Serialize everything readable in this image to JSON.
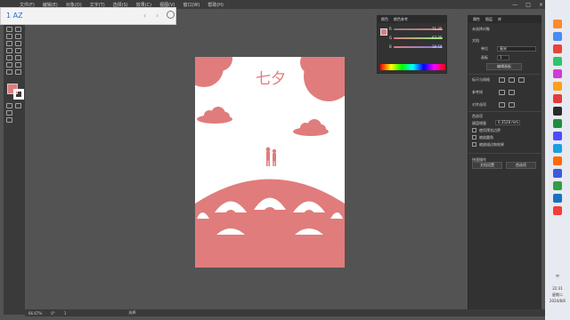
{
  "menubar": {
    "items": [
      "文件(F)",
      "编辑(E)",
      "对象(O)",
      "文字(T)",
      "选择(S)",
      "效果(C)",
      "视图(V)",
      "窗口(W)",
      "帮助(H)"
    ],
    "window_controls": [
      "—",
      "□",
      "×"
    ]
  },
  "browser_tab": {
    "title": "AZ",
    "tab_index": "1",
    "back": "‹",
    "forward": "›"
  },
  "artboard": {
    "headline": "七夕",
    "fill_color": "#e07c7c"
  },
  "color_panel": {
    "tabs": [
      "颜色",
      "颜色参考"
    ],
    "channels": [
      {
        "label": "R",
        "value": "71.25"
      },
      {
        "label": "G",
        "value": "67.75"
      },
      {
        "label": "B",
        "value": "38.58"
      }
    ]
  },
  "properties": {
    "tabs": [
      "属性",
      "图层",
      "库"
    ],
    "section_doc": "未选择对象",
    "doc_label": "文档",
    "units_label": "单位",
    "units_value": "毫米",
    "artboard_label": "画板",
    "artboard_value": "1",
    "edit_artboard": "编辑画板",
    "rulers_label": "标尺与网格",
    "guides_label": "参考线",
    "align_label": "对齐选项",
    "prefs_label": "首选项",
    "keyboard_increment_label": "键盘增量",
    "keyboard_increment_value": "0.3528 mm",
    "checks": [
      "使用预览边界",
      "缩放圆角",
      "缩放描边和效果"
    ],
    "quick_actions": "快速操作",
    "doc_setup": "文档设置",
    "preferences": "首选项"
  },
  "statusbar": {
    "zoom": "66.67%",
    "rotation": "0°",
    "page": "1",
    "tool": "选择"
  },
  "taskbar": {
    "lang": "中",
    "time": "22:31",
    "weekday": "星期二",
    "date": "2024/8/6"
  }
}
